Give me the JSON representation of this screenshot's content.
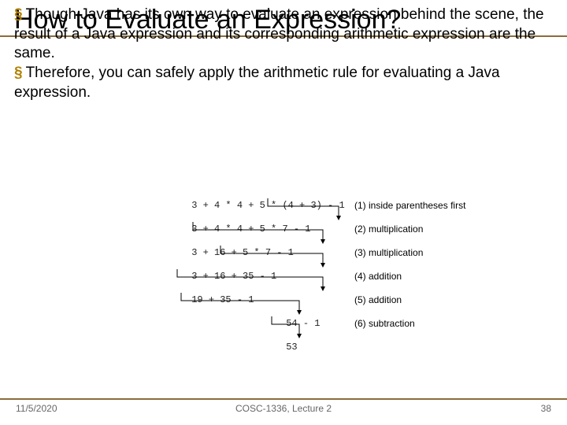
{
  "title": "How to Evaluate an Expression?",
  "bullets": [
    "Though Java has its own way to evaluate an expression behind the scene, the result of a Java expression and its corresponding arithmetic expression are the same.",
    "Therefore, you can safely apply the arithmetic rule for evaluating a Java expression."
  ],
  "worked": {
    "lines": [
      "3 + 4 * 4 + 5 * (4 + 3) - 1",
      "3 + 4 * 4 + 5 * 7 - 1",
      "3 + 16 + 5 * 7 - 1",
      "3 + 16 + 35 - 1",
      "19 + 35 - 1",
      "54 - 1",
      "53"
    ],
    "annotations": [
      "(1) inside parentheses first",
      "(2) multiplication",
      "(3) multiplication",
      "(4) addition",
      "(5) addition",
      "(6) subtraction"
    ]
  },
  "footer": {
    "date": "11/5/2020",
    "course": "COSC-1336, Lecture 2",
    "page": "38"
  }
}
